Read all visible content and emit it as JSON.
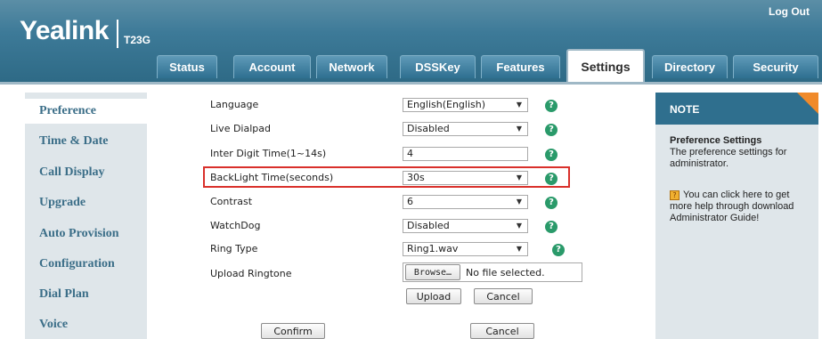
{
  "brand": {
    "logo": "Yealink",
    "model": "T23G"
  },
  "header": {
    "logout": "Log Out"
  },
  "tabs": [
    {
      "label": "Status"
    },
    {
      "label": "Account"
    },
    {
      "label": "Network"
    },
    {
      "label": "DSSKey"
    },
    {
      "label": "Features"
    },
    {
      "label": "Settings"
    },
    {
      "label": "Directory"
    },
    {
      "label": "Security"
    }
  ],
  "active_tab": "Settings",
  "sidebar": {
    "items": [
      {
        "label": "Preference"
      },
      {
        "label": "Time & Date"
      },
      {
        "label": "Call Display"
      },
      {
        "label": "Upgrade"
      },
      {
        "label": "Auto Provision"
      },
      {
        "label": "Configuration"
      },
      {
        "label": "Dial Plan"
      },
      {
        "label": "Voice"
      }
    ],
    "active": "Preference"
  },
  "form": {
    "language": {
      "label": "Language",
      "value": "English(English)"
    },
    "live_dialpad": {
      "label": "Live Dialpad",
      "value": "Disabled"
    },
    "inter_digit": {
      "label": "Inter Digit Time(1~14s)",
      "value": "4"
    },
    "backlight": {
      "label": "BackLight Time(seconds)",
      "value": "30s"
    },
    "contrast": {
      "label": "Contrast",
      "value": "6"
    },
    "watchdog": {
      "label": "WatchDog",
      "value": "Disabled"
    },
    "ring_type": {
      "label": "Ring Type",
      "value": "Ring1.wav"
    },
    "upload_ringtone": {
      "label": "Upload Ringtone",
      "browse": "Browse…",
      "file_status": "No file selected.",
      "upload": "Upload",
      "cancel": "Cancel"
    },
    "confirm": "Confirm",
    "cancel": "Cancel"
  },
  "note": {
    "title": "NOTE",
    "heading": "Preference Settings",
    "line1": "The preference settings for",
    "line2": "administrator.",
    "help1": "You can click here to get",
    "help2": "more help through download",
    "help3": "Administrator Guide!"
  },
  "colors": {
    "accent": "#2f6f8e",
    "highlight": "#d9302b",
    "help_icon": "#2a9a6a"
  }
}
